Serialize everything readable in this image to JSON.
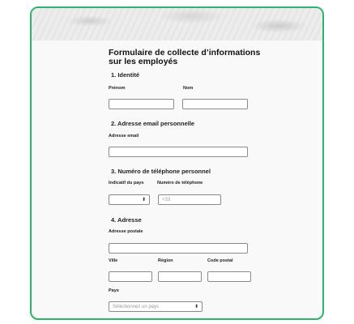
{
  "form": {
    "title": "Formulaire de collecte d’informations sur les employés",
    "identity": {
      "heading": "1. Identité",
      "first_name_label": "Prénom",
      "last_name_label": "Nom"
    },
    "email": {
      "heading": "2. Adresse email personnelle",
      "email_label": "Adresse email"
    },
    "phone": {
      "heading": "3. Numéro de téléphone personnel",
      "country_code_label": "Indicatif du pays",
      "phone_label": "Numéro de téléphone",
      "phone_placeholder": "+33"
    },
    "address": {
      "heading": "4. Adresse",
      "postal_label": "Adresse postale",
      "city_label": "Ville",
      "region_label": "Région",
      "zip_label": "Code postal",
      "country_label": "Pays",
      "country_placeholder": "Sélectionnez un pays"
    }
  },
  "colors": {
    "frame_border": "#2db36b"
  }
}
